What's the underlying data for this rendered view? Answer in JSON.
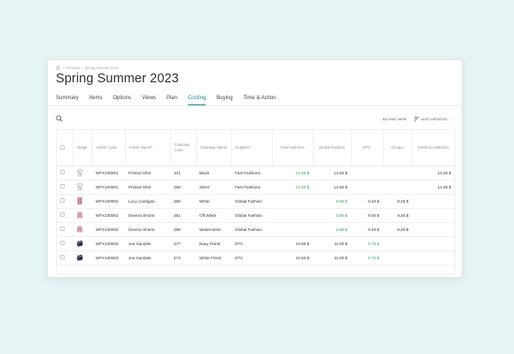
{
  "breadcrumb": [
    "Products",
    "Spring Summer 2023"
  ],
  "page_title": "Spring Summer 2023",
  "tabs": [
    {
      "label": "Summary",
      "active": false
    },
    {
      "label": "Items",
      "active": false
    },
    {
      "label": "Options",
      "active": false
    },
    {
      "label": "Views",
      "active": false
    },
    {
      "label": "Plan",
      "active": false
    },
    {
      "label": "Costing",
      "active": true
    },
    {
      "label": "Buying",
      "active": false
    },
    {
      "label": "Time & Action",
      "active": false
    }
  ],
  "toolbar": {
    "buying_view": "BUYING VIEW",
    "last_updated": "LAST UPDATED ..."
  },
  "columns": [
    "Image",
    "Article Code",
    "Article Name*",
    "Colorway Code",
    "Colorway Name",
    "Supplier*",
    "Fast Fashions",
    "Global Fashion",
    "DTC",
    "Clingyo",
    "Fashion Institution"
  ],
  "rows": [
    {
      "image": "shirt",
      "code": "WFX100001",
      "name": "Printed Shirt",
      "cw_code": "101",
      "cw_name": "Black",
      "supplier": "Fast Fashions",
      "fast": "13.30 $",
      "global": "12.50 $",
      "dtc": "",
      "clingyo": "",
      "fi": "13.30 $",
      "green": "fast"
    },
    {
      "image": "shirt",
      "code": "WFX100001",
      "name": "Printed Shirt",
      "cw_code": "258",
      "cw_name": "Silver",
      "supplier": "Fast Fashions",
      "fast": "13.30 $",
      "global": "12.50 $",
      "dtc": "",
      "clingyo": "",
      "fi": "14.30 $",
      "green": "fast"
    },
    {
      "image": "cardigan",
      "code": "WFX100002",
      "name": "Lucy Cardigan",
      "cw_code": "259",
      "cw_name": "White",
      "supplier": "Global Fashion",
      "fast": "",
      "global": "8.90 $",
      "dtc": "9.40 $",
      "clingyo": "9.25 $",
      "fi": "",
      "green": "global"
    },
    {
      "image": "shorts",
      "code": "WFX100002",
      "name": "Devera Shorts",
      "cw_code": "261",
      "cw_name": "Off White",
      "supplier": "Global Fashion",
      "fast": "",
      "global": "8.90 $",
      "dtc": "9.40 $",
      "clingyo": "9.25 $",
      "fi": "",
      "green": "global"
    },
    {
      "image": "shorts",
      "code": "WFX100002",
      "name": "Devera Shorts",
      "cw_code": "289",
      "cw_name": "Watermelon",
      "supplier": "Global Fashion",
      "fast": "",
      "global": "8.90 $",
      "dtc": "9.40 $",
      "clingyo": "9.25 $",
      "fi": "",
      "green": "global"
    },
    {
      "image": "sandal",
      "code": "WFX100003",
      "name": "Joe Sandals",
      "cw_code": "477",
      "cw_name": "Navy Floral",
      "supplier": "DTC",
      "fast": "10.50 $",
      "global": "11.00 $",
      "dtc": "9.70 $",
      "clingyo": "",
      "fi": "",
      "green": "dtc"
    },
    {
      "image": "sandal",
      "code": "WFX100003",
      "name": "Joe Sandals",
      "cw_code": "473",
      "cw_name": "White Floral",
      "supplier": "DTC",
      "fast": "10.50 $",
      "global": "11.00 $",
      "dtc": "9.70 $",
      "clingyo": "",
      "fi": "",
      "green": "dtc"
    }
  ],
  "colors": {
    "accent": "#1d8b92",
    "lowest_cost": "#2f9e54",
    "background": "#e7f4f6"
  }
}
